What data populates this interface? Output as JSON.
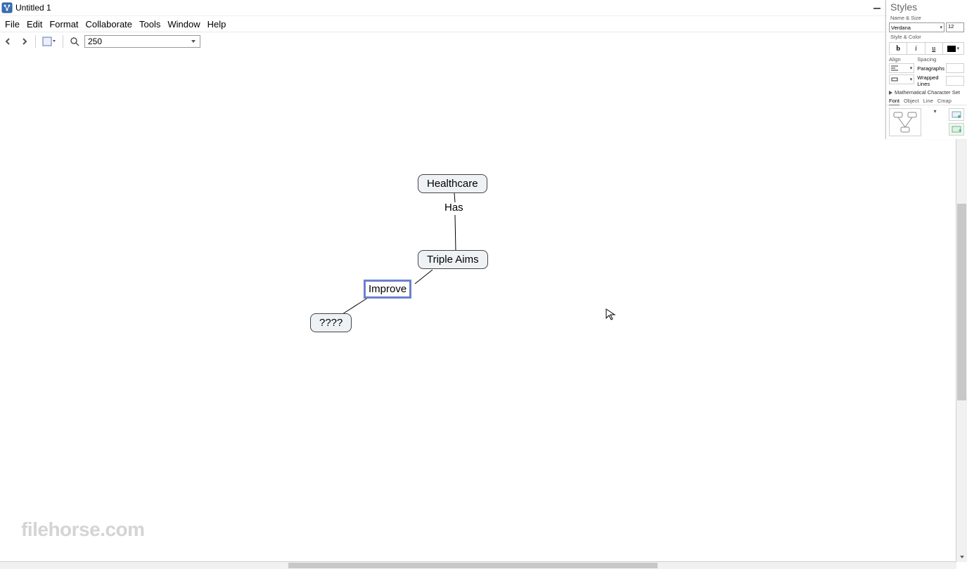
{
  "titlebar": {
    "title": "Untitled 1"
  },
  "menubar": {
    "items": [
      {
        "label": "File"
      },
      {
        "label": "Edit"
      },
      {
        "label": "Format"
      },
      {
        "label": "Collaborate"
      },
      {
        "label": "Tools"
      },
      {
        "label": "Window"
      },
      {
        "label": "Help"
      }
    ]
  },
  "toolbar": {
    "zoom_value": "250"
  },
  "canvas": {
    "nodes": {
      "healthcare": "Healthcare",
      "triple_aims": "Triple Aims",
      "unknown": "????"
    },
    "labels": {
      "has": "Has",
      "improve": "Improve"
    }
  },
  "styles_panel": {
    "title": "Styles",
    "sections": {
      "name_size": "Name & Size",
      "style_color": "Style & Color",
      "align": "Align",
      "spacing": "Spacing",
      "paragraphs": "Paragraphs",
      "wrapped": "Wrapped Lines",
      "math": "Mathematical Character Set"
    },
    "font_name": "Verdana",
    "font_size": "12",
    "format_btns": {
      "bold": "b",
      "italic": "i",
      "underline": "u"
    },
    "tabs": [
      {
        "label": "Font",
        "active": true
      },
      {
        "label": "Object",
        "active": false
      },
      {
        "label": "Line",
        "active": false
      },
      {
        "label": "Cmap",
        "active": false
      }
    ]
  },
  "watermark": {
    "brand": "filehorse",
    "tld": ".com"
  }
}
